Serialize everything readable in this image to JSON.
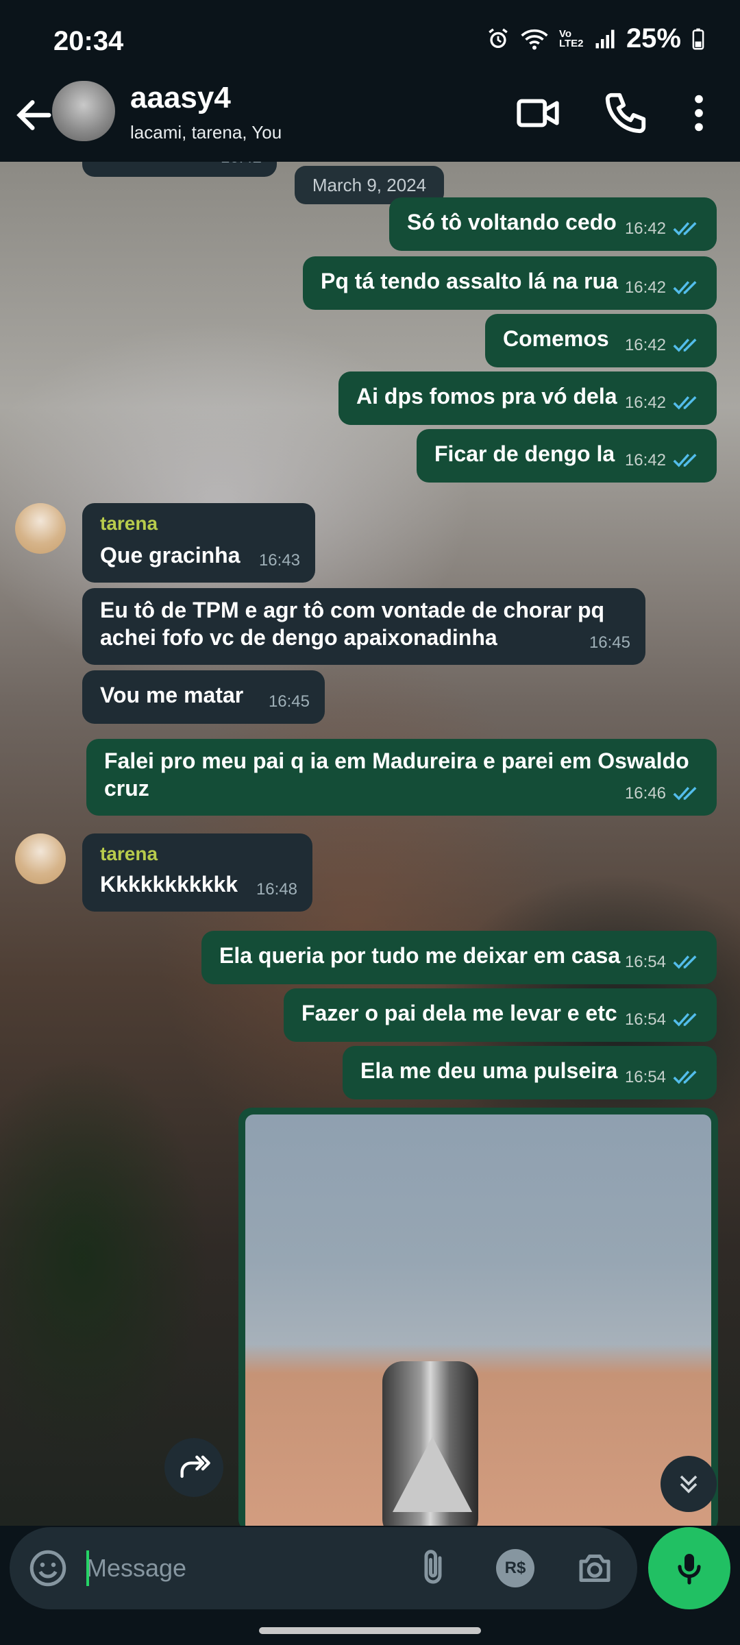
{
  "status_bar": {
    "time": "20:34",
    "network_label": "Vo LTE2",
    "battery": "25%"
  },
  "header": {
    "group_name": "aaasy4",
    "members": "lacami, tarena, You"
  },
  "date_chip": "March 9, 2024",
  "partial_top_time": "16:42",
  "messages": [
    {
      "dir": "out",
      "text": "Só tô voltando cedo",
      "time": "16:42"
    },
    {
      "dir": "out",
      "text": "Pq tá tendo assalto lá na rua",
      "time": "16:42"
    },
    {
      "dir": "out",
      "text": "Comemos",
      "time": "16:42"
    },
    {
      "dir": "out",
      "text": "Ai dps fomos pra vó dela",
      "time": "16:42"
    },
    {
      "dir": "out",
      "text": "Ficar de dengo la",
      "time": "16:42"
    },
    {
      "dir": "in",
      "sender": "tarena",
      "text": "Que gracinha",
      "time": "16:43"
    },
    {
      "dir": "in",
      "text": "Eu tô de TPM e agr tô com vontade de chorar pq achei fofo vc de dengo apaixonadinha",
      "time": "16:45"
    },
    {
      "dir": "in",
      "text": "Vou me matar",
      "time": "16:45"
    },
    {
      "dir": "out",
      "text": "Falei pro meu pai q ia em Madureira e parei em Oswaldo cruz",
      "time": "16:46"
    },
    {
      "dir": "in",
      "sender": "tarena",
      "text": "Kkkkkkkkkkk",
      "time": "16:48"
    },
    {
      "dir": "out",
      "text": "Ela queria por tudo me deixar em casa",
      "time": "16:54"
    },
    {
      "dir": "out",
      "text": "Fazer o pai dela me levar e etc",
      "time": "16:54"
    },
    {
      "dir": "out",
      "text": "Ela me deu uma pulseira",
      "time": "16:54"
    }
  ],
  "composer": {
    "placeholder": "Message",
    "currency_icon_label": "R$"
  },
  "icons": {
    "back": "arrow-left-icon",
    "video": "video-call-icon",
    "call": "phone-icon",
    "menu": "more-vert-icon",
    "emoji": "emoji-icon",
    "attach": "paperclip-icon",
    "camera": "camera-icon",
    "mic": "mic-icon",
    "forward": "forward-icon",
    "scroll_down": "double-chevron-down-icon",
    "read": "double-check-icon"
  },
  "colors": {
    "outgoing_bubble": "#144d37",
    "incoming_bubble": "#1f2c34",
    "accent": "#21c063",
    "tick_read": "#53bdeb",
    "sender_name": "#b8cc4c"
  }
}
